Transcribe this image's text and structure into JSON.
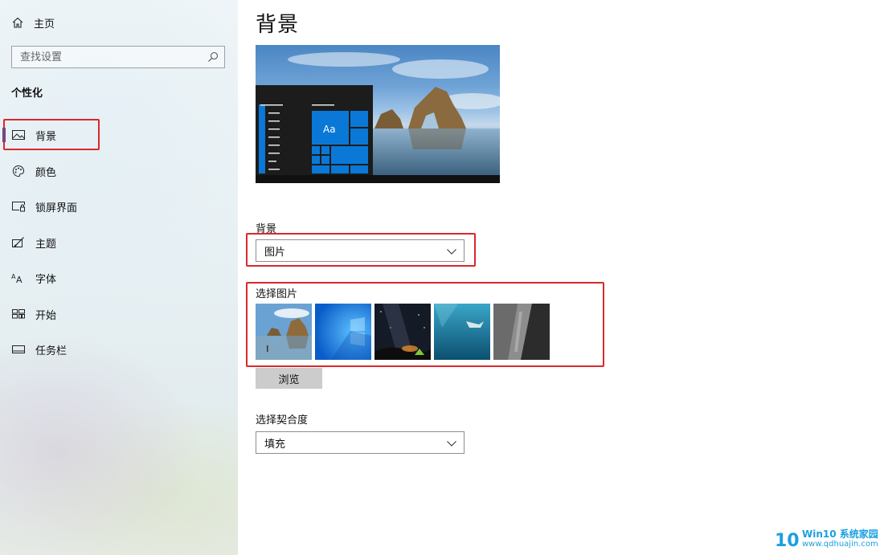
{
  "sidebar": {
    "home_label": "主页",
    "search_placeholder": "查找设置",
    "section_title": "个性化",
    "items": [
      {
        "label": "背景",
        "icon": "picture-icon",
        "active": true
      },
      {
        "label": "颜色",
        "icon": "palette-icon"
      },
      {
        "label": "锁屏界面",
        "icon": "lock-screen-icon"
      },
      {
        "label": "主题",
        "icon": "theme-brush-icon"
      },
      {
        "label": "字体",
        "icon": "font-icon"
      },
      {
        "label": "开始",
        "icon": "start-tiles-icon"
      },
      {
        "label": "任务栏",
        "icon": "taskbar-icon"
      }
    ]
  },
  "main": {
    "title": "背景",
    "preview_tile_label": "Aa",
    "background_label": "背景",
    "background_value": "图片",
    "choose_picture_label": "选择图片",
    "browse_label": "浏览",
    "fit_label": "选择契合度",
    "fit_value": "填充"
  },
  "watermark": {
    "brand": "Win10 系统家园",
    "url": "www.qdhuajin.com"
  },
  "colors": {
    "accent": "#0a64c8",
    "highlight": "#d9282b",
    "tile_blue": "#0a78d7"
  }
}
